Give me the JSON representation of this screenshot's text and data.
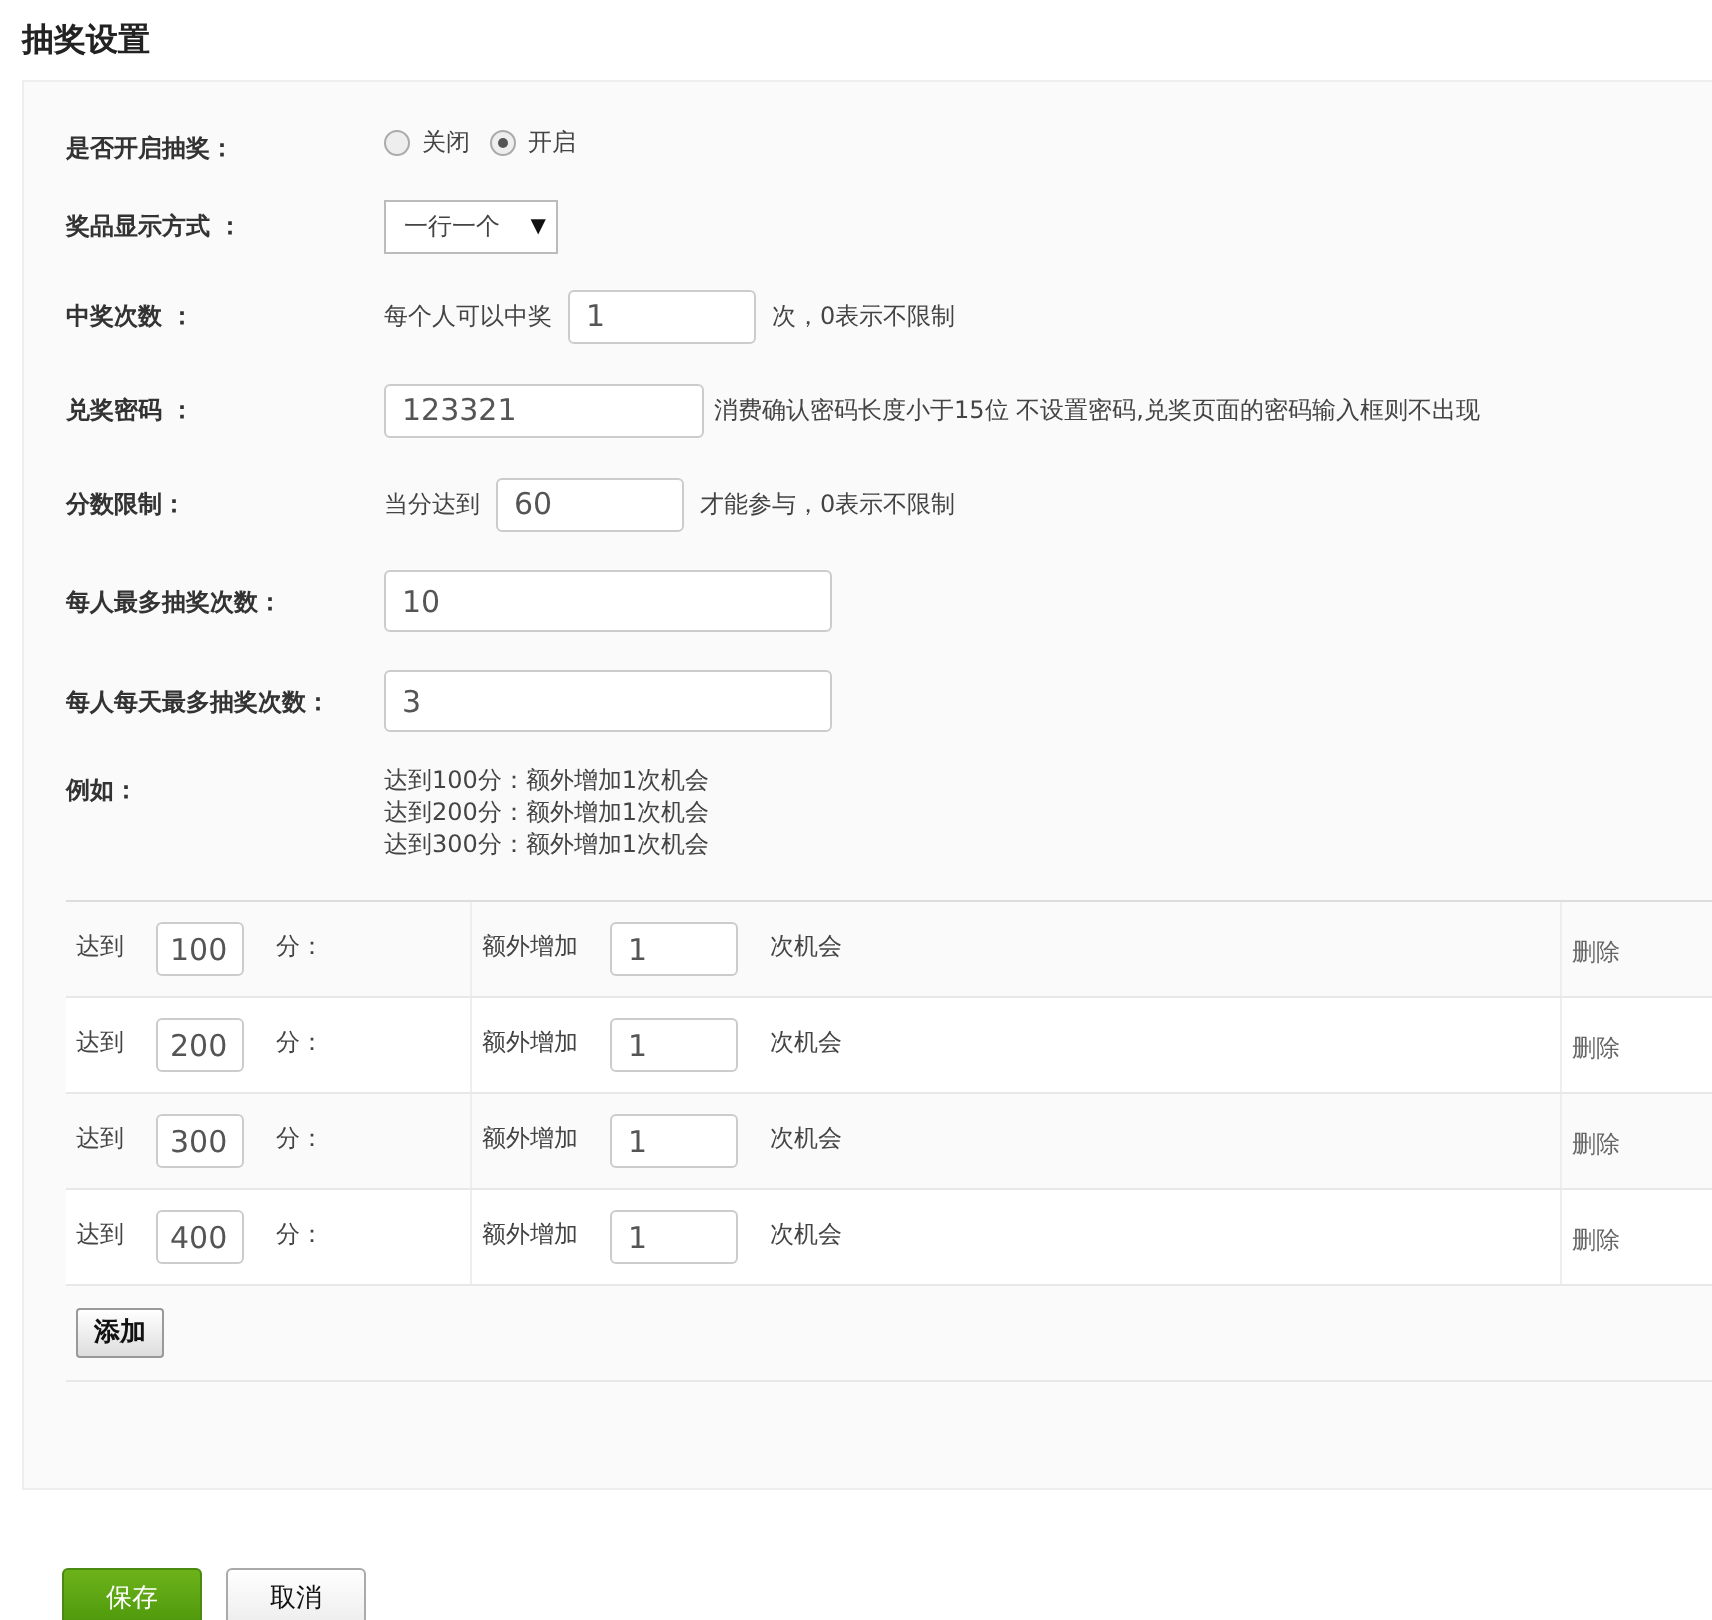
{
  "title": "抽奖设置",
  "enable": {
    "label": "是否开启抽奖：",
    "options": [
      {
        "label": "关闭",
        "selected": false
      },
      {
        "label": "开启",
        "selected": true
      }
    ]
  },
  "display_mode": {
    "label": "奖品显示方式 ：",
    "value": "一行一个",
    "caret": "▼"
  },
  "win_count": {
    "label": "中奖次数 ：",
    "prefix": "每个人可以中奖",
    "value": "1",
    "suffix": "次，0表示不限制"
  },
  "password": {
    "label": "兑奖密码 ：",
    "value": "123321",
    "hint": "消费确认密码长度小于15位 不设置密码,兑奖页面的密码输入框则不出现"
  },
  "score_limit": {
    "label": "分数限制：",
    "prefix": "当分达到",
    "value": "60",
    "suffix": "才能参与，0表示不限制"
  },
  "max_draws": {
    "label": "每人最多抽奖次数：",
    "value": "10"
  },
  "max_daily_draws": {
    "label": "每人每天最多抽奖次数：",
    "value": "3"
  },
  "example": {
    "label": "例如：",
    "lines": [
      "达到100分：额外增加1次机会",
      "达到200分：额外增加1次机会",
      "达到300分：额外增加1次机会"
    ]
  },
  "rules": [
    {
      "reach": "达到",
      "score": "100",
      "unit": "分：",
      "extra": "额外增加",
      "count": "1",
      "chance": "次机会",
      "delete": "删除"
    },
    {
      "reach": "达到",
      "score": "200",
      "unit": "分：",
      "extra": "额外增加",
      "count": "1",
      "chance": "次机会",
      "delete": "删除"
    },
    {
      "reach": "达到",
      "score": "300",
      "unit": "分：",
      "extra": "额外增加",
      "count": "1",
      "chance": "次机会",
      "delete": "删除"
    },
    {
      "reach": "达到",
      "score": "400",
      "unit": "分：",
      "extra": "额外增加",
      "count": "1",
      "chance": "次机会",
      "delete": "删除"
    }
  ],
  "add_button": "添加",
  "buttons": [
    {
      "kind": "primary",
      "label": "保存"
    },
    {
      "kind": "secondary",
      "label": "取消"
    }
  ]
}
